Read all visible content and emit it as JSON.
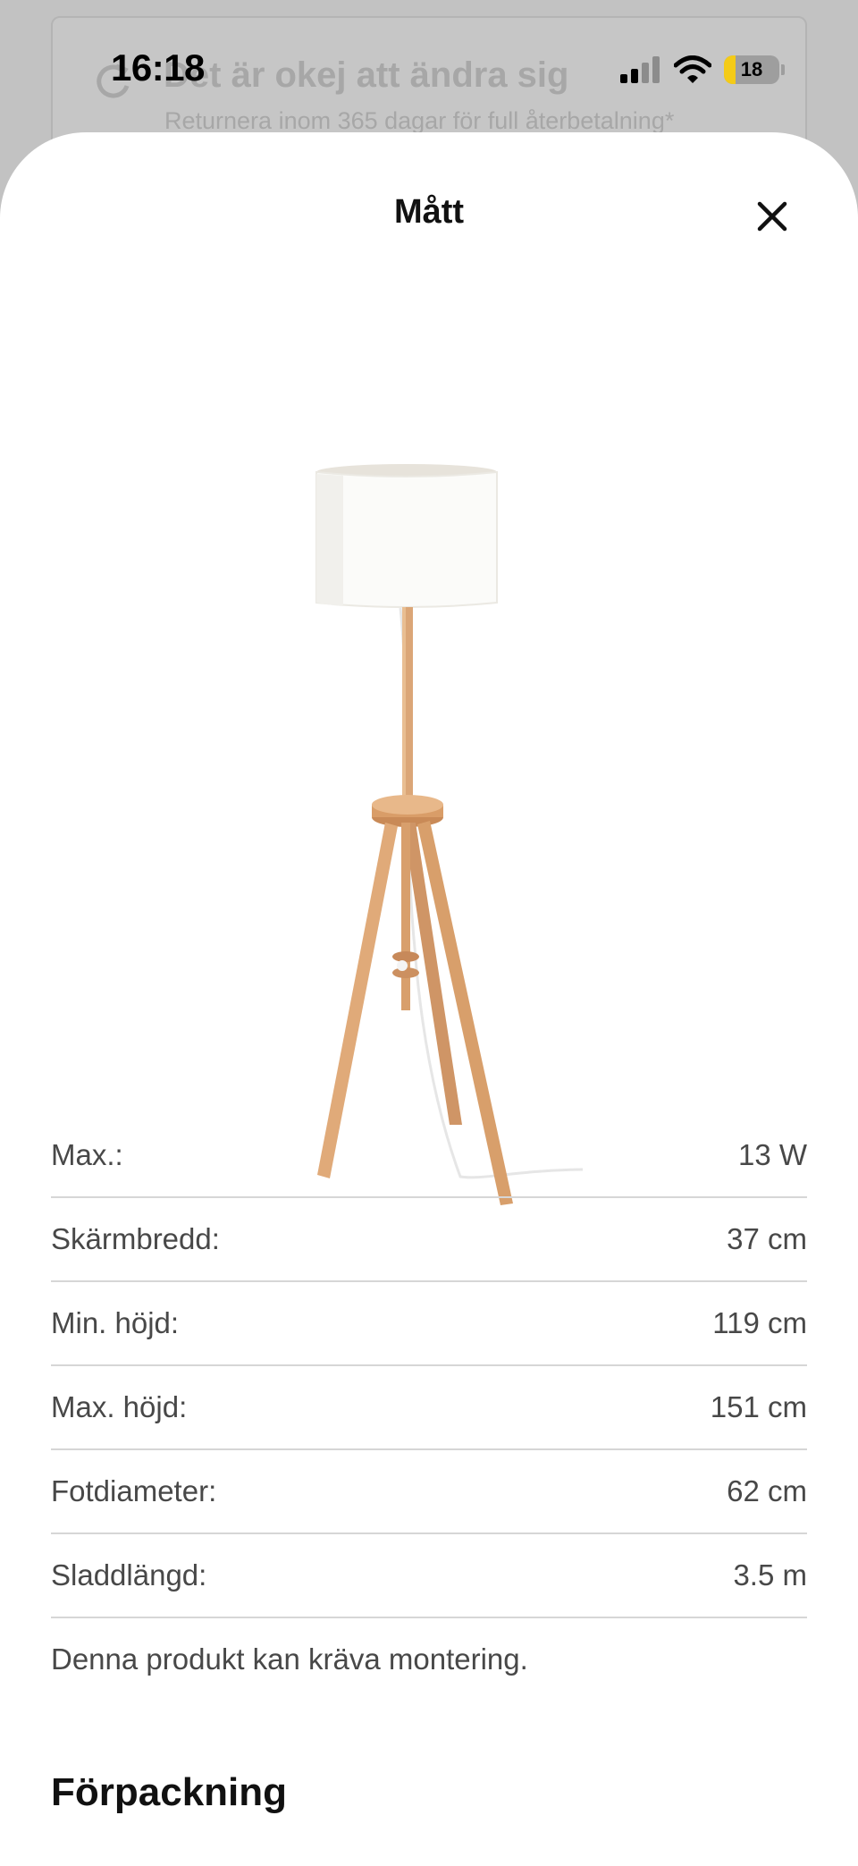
{
  "status_bar": {
    "time": "16:18",
    "battery_level": "18",
    "icons": [
      "signal-icon",
      "wifi-icon",
      "battery-icon"
    ]
  },
  "background_page": {
    "banner_title": "Det är okej att ändra sig",
    "banner_subtitle": "Returnera inom 365 dagar för full återbetalning*",
    "banner_icon": "return-arrow-icon"
  },
  "sheet": {
    "title": "Mått",
    "close_icon": "close-icon",
    "product_image": "floor-lamp-tripod-image",
    "specs": [
      {
        "label": "Max.:",
        "value": "13 W"
      },
      {
        "label": "Skärmbredd:",
        "value": "37 cm"
      },
      {
        "label": "Min. höjd:",
        "value": "119 cm"
      },
      {
        "label": "Max. höjd:",
        "value": "151 cm"
      },
      {
        "label": "Fotdiameter:",
        "value": "62 cm"
      },
      {
        "label": "Sladdlängd:",
        "value": "3.5 m"
      }
    ],
    "assembly_note": "Denna produkt kan kräva montering.",
    "packaging_heading": "Förpackning"
  },
  "colors": {
    "overlay": "#c2c2c2",
    "sheet_bg": "#ffffff",
    "text_primary": "#111111",
    "text_secondary": "#484848",
    "divider": "#d6d6d6",
    "battery_fill": "#f4cb17"
  }
}
